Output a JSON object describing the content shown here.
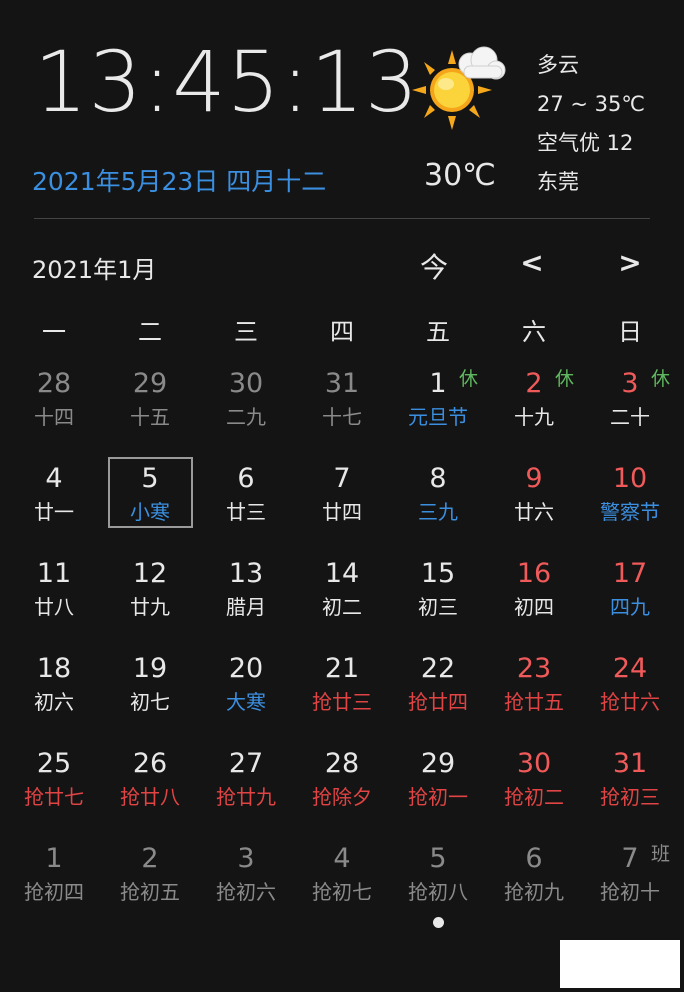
{
  "clock": {
    "time": "13:45:13",
    "date": "2021年5月23日 四月十二"
  },
  "weather": {
    "icon": "partly-cloudy-sun-icon",
    "temp_now": "30℃",
    "condition": "多云",
    "range": "27 ~ 35℃",
    "air": "空气优 12",
    "city": "东莞"
  },
  "calendar": {
    "month_label": "2021年1月",
    "nav": {
      "today": "今",
      "prev": "<",
      "next": ">"
    },
    "weekdays": [
      "一",
      "二",
      "三",
      "四",
      "五",
      "六",
      "日"
    ],
    "weeks": [
      [
        {
          "d": "28",
          "l": "十四",
          "dc": "dim",
          "lc": "dim"
        },
        {
          "d": "29",
          "l": "十五",
          "dc": "dim",
          "lc": "dim"
        },
        {
          "d": "30",
          "l": "二九",
          "dc": "dim",
          "lc": "dim"
        },
        {
          "d": "31",
          "l": "十七",
          "dc": "dim",
          "lc": "dim"
        },
        {
          "d": "1",
          "l": "元旦节",
          "dc": "white",
          "lc": "blue",
          "b": "休",
          "bc": "green"
        },
        {
          "d": "2",
          "l": "十九",
          "dc": "red",
          "lc": "white",
          "b": "休",
          "bc": "green"
        },
        {
          "d": "3",
          "l": "二十",
          "dc": "red",
          "lc": "white",
          "b": "休",
          "bc": "green"
        }
      ],
      [
        {
          "d": "4",
          "l": "廿一",
          "dc": "white",
          "lc": "white"
        },
        {
          "d": "5",
          "l": "小寒",
          "dc": "white",
          "lc": "blue",
          "sel": true
        },
        {
          "d": "6",
          "l": "廿三",
          "dc": "white",
          "lc": "white"
        },
        {
          "d": "7",
          "l": "廿四",
          "dc": "white",
          "lc": "white"
        },
        {
          "d": "8",
          "l": "三九",
          "dc": "white",
          "lc": "blue"
        },
        {
          "d": "9",
          "l": "廿六",
          "dc": "red",
          "lc": "white"
        },
        {
          "d": "10",
          "l": "警察节",
          "dc": "red",
          "lc": "blue"
        }
      ],
      [
        {
          "d": "11",
          "l": "廿八",
          "dc": "white",
          "lc": "white"
        },
        {
          "d": "12",
          "l": "廿九",
          "dc": "white",
          "lc": "white"
        },
        {
          "d": "13",
          "l": "腊月",
          "dc": "white",
          "lc": "white"
        },
        {
          "d": "14",
          "l": "初二",
          "dc": "white",
          "lc": "white"
        },
        {
          "d": "15",
          "l": "初三",
          "dc": "white",
          "lc": "white"
        },
        {
          "d": "16",
          "l": "初四",
          "dc": "red",
          "lc": "white"
        },
        {
          "d": "17",
          "l": "四九",
          "dc": "red",
          "lc": "blue"
        }
      ],
      [
        {
          "d": "18",
          "l": "初六",
          "dc": "white",
          "lc": "white"
        },
        {
          "d": "19",
          "l": "初七",
          "dc": "white",
          "lc": "white"
        },
        {
          "d": "20",
          "l": "大寒",
          "dc": "white",
          "lc": "blue"
        },
        {
          "d": "21",
          "l": "抢廿三",
          "dc": "white",
          "lc": "redtxt"
        },
        {
          "d": "22",
          "l": "抢廿四",
          "dc": "white",
          "lc": "redtxt"
        },
        {
          "d": "23",
          "l": "抢廿五",
          "dc": "red",
          "lc": "redtxt"
        },
        {
          "d": "24",
          "l": "抢廿六",
          "dc": "red",
          "lc": "redtxt"
        }
      ],
      [
        {
          "d": "25",
          "l": "抢廿七",
          "dc": "white",
          "lc": "redtxt"
        },
        {
          "d": "26",
          "l": "抢廿八",
          "dc": "white",
          "lc": "redtxt"
        },
        {
          "d": "27",
          "l": "抢廿九",
          "dc": "white",
          "lc": "redtxt"
        },
        {
          "d": "28",
          "l": "抢除夕",
          "dc": "white",
          "lc": "redtxt"
        },
        {
          "d": "29",
          "l": "抢初一",
          "dc": "white",
          "lc": "redtxt"
        },
        {
          "d": "30",
          "l": "抢初二",
          "dc": "red",
          "lc": "redtxt"
        },
        {
          "d": "31",
          "l": "抢初三",
          "dc": "red",
          "lc": "redtxt"
        }
      ],
      [
        {
          "d": "1",
          "l": "抢初四",
          "dc": "dim",
          "lc": "dim"
        },
        {
          "d": "2",
          "l": "抢初五",
          "dc": "dim",
          "lc": "dim"
        },
        {
          "d": "3",
          "l": "抢初六",
          "dc": "dim",
          "lc": "dim"
        },
        {
          "d": "4",
          "l": "抢初七",
          "dc": "dim",
          "lc": "dim"
        },
        {
          "d": "5",
          "l": "抢初八",
          "dc": "dim",
          "lc": "dim"
        },
        {
          "d": "6",
          "l": "抢初九",
          "dc": "dim",
          "lc": "dim"
        },
        {
          "d": "7",
          "l": "抢初十",
          "dc": "dim",
          "lc": "dim",
          "b": "班",
          "bc": "dim"
        }
      ]
    ]
  },
  "colors": {
    "background": "#141414",
    "blue": "#3b8fe0",
    "red": "#f05a5a",
    "green": "#5fb85f",
    "dim": "#8a8a8a"
  }
}
